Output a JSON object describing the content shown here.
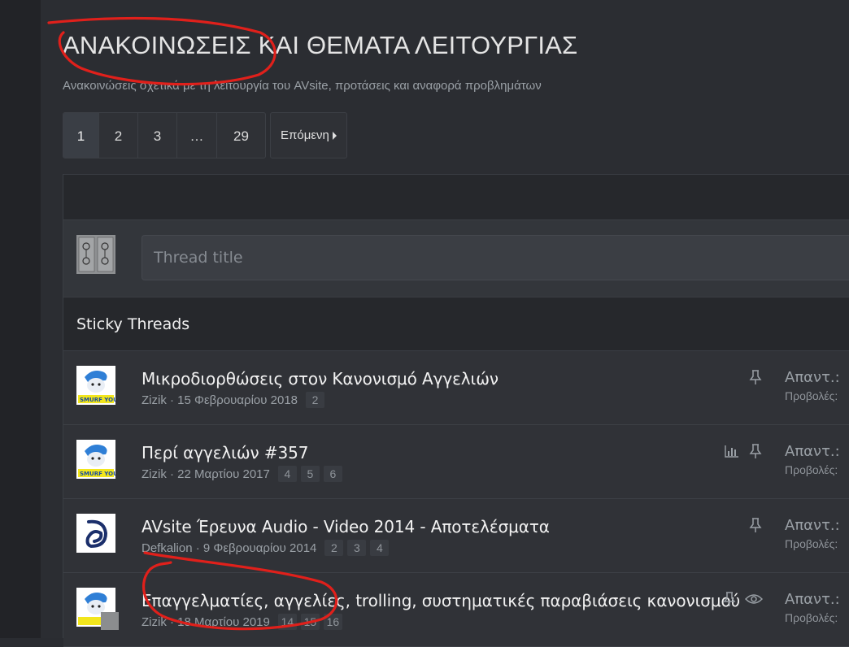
{
  "forum": {
    "title": "ΑΝΑΚΟΙΝΩΣΕΙΣ ΚΑΙ ΘΕΜΑΤΑ ΛΕΙΤΟΥΡΓΙΑΣ",
    "description": "Ανακοινώσεις σχετικά με τη λειτουργία του AVsite, προτάσεις και αναφορά προβλημάτων"
  },
  "pagination": {
    "pages": [
      "1",
      "2",
      "3",
      "…",
      "29"
    ],
    "current": "1",
    "next_label": "Επόμενη"
  },
  "quick_thread": {
    "placeholder": "Thread title"
  },
  "sticky": {
    "header": "Sticky Threads",
    "threads": [
      {
        "title": "Μικροδιορθώσεις στον Κανονισμό Αγγελιών",
        "author": "Zizik",
        "date": "15 Φεβρουαρίου 2018",
        "pages": [
          "2"
        ],
        "icons": [
          "pin-icon"
        ],
        "replies_label": "Απαντ.:",
        "views_label": "Προβολές:",
        "avatar": "smurf-avatar"
      },
      {
        "title": "Περί αγγελιών #357",
        "author": "Zizik",
        "date": "22 Μαρτίου 2017",
        "pages": [
          "4",
          "5",
          "6"
        ],
        "icons": [
          "poll-icon",
          "pin-icon"
        ],
        "replies_label": "Απαντ.:",
        "views_label": "Προβολές:",
        "avatar": "smurf-avatar"
      },
      {
        "title": "AVsite Έρευνα Audio - Video 2014 - Αποτελέσματα",
        "author": "Defkalion",
        "date": "9 Φεβρουαρίου 2014",
        "pages": [
          "2",
          "3",
          "4"
        ],
        "icons": [
          "pin-icon"
        ],
        "replies_label": "Απαντ.:",
        "views_label": "Προβολές:",
        "avatar": "d-logo-avatar"
      },
      {
        "title": "Επαγγελματίες, αγγελίες, trolling, συστηματικές παραβιάσεις κανονισμού",
        "author": "Zizik",
        "date": "18 Μαρτίου 2019",
        "pages": [
          "14",
          "15",
          "16"
        ],
        "icons": [
          "pin-icon",
          "watch-eye-icon"
        ],
        "replies_label": "Απαντ.:",
        "views_label": "Προβολές:",
        "avatar": "smurf-avatar"
      }
    ]
  },
  "colors": {
    "background": "#2b2d32",
    "header_bar": "#26282c",
    "annotation_red": "#e0201b"
  }
}
